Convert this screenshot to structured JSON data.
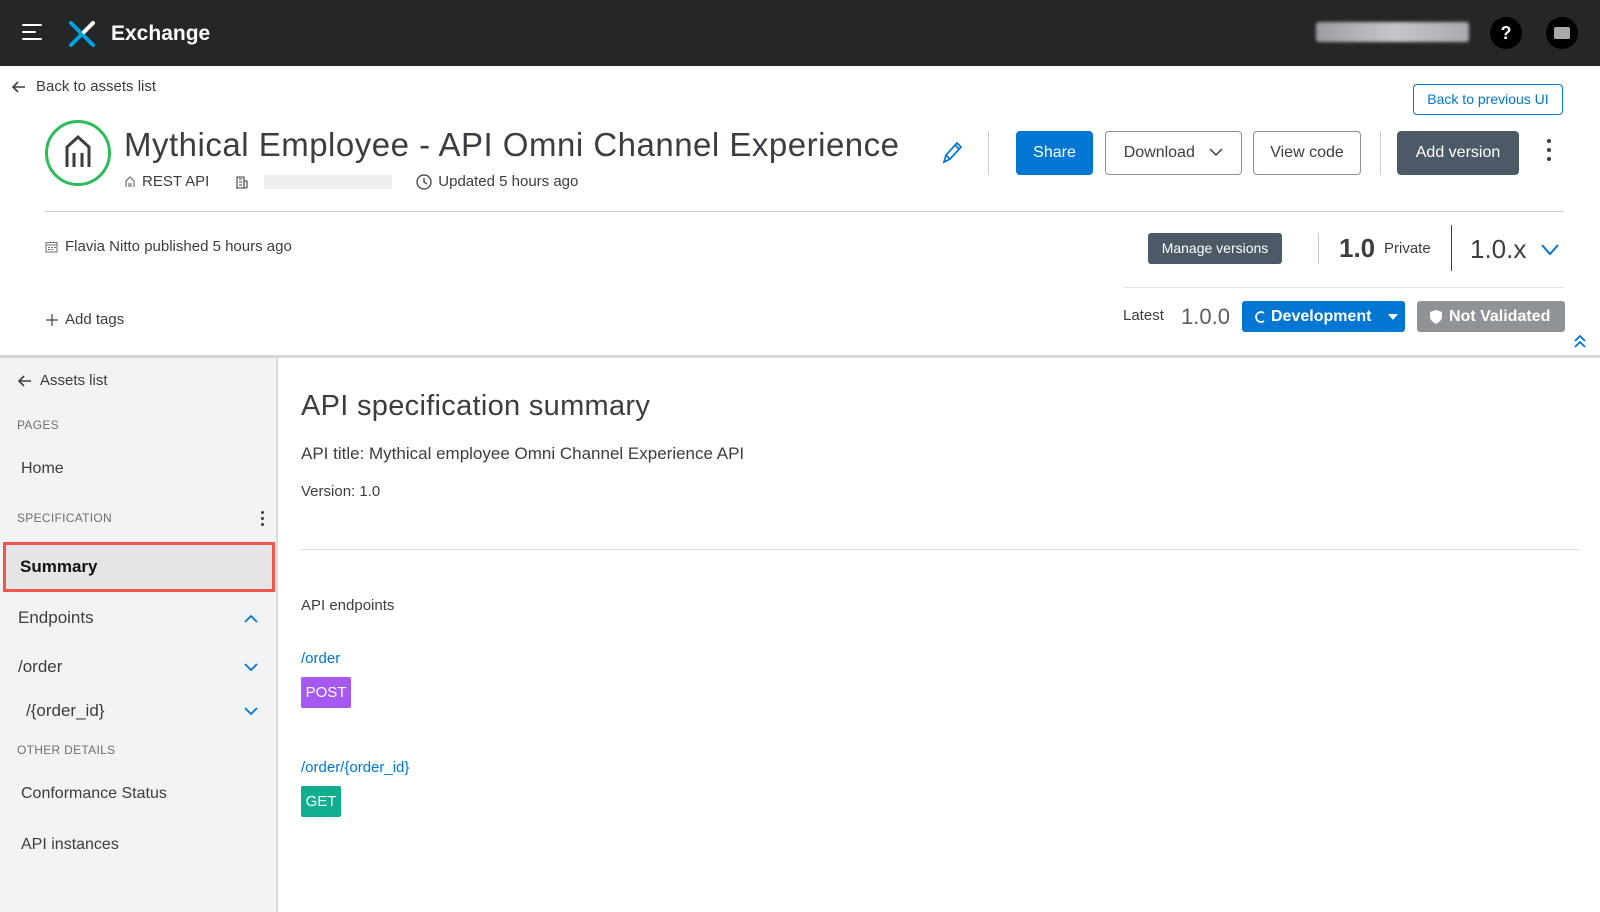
{
  "topbar": {
    "app_name": "Exchange",
    "help_label": "?"
  },
  "header": {
    "back_label": "Back to assets list",
    "back_prev_ui": "Back to previous UI",
    "title": "Mythical Employee - API Omni Channel Experience",
    "asset_type": "REST API",
    "updated": "Updated 5 hours ago",
    "share": "Share",
    "download": "Download",
    "view_code": "View code",
    "add_version": "Add version",
    "published": "Flavia Nitto published 5 hours ago",
    "manage_versions": "Manage versions",
    "version": "1.0",
    "visibility": "Private",
    "version_select": "1.0.x",
    "add_tags": "Add tags",
    "latest_label": "Latest",
    "latest_version": "1.0.0",
    "lifecycle": "Development",
    "validation": "Not Validated"
  },
  "sidebar": {
    "back_label": "Assets list",
    "section_pages": "PAGES",
    "home": "Home",
    "section_spec": "SPECIFICATION",
    "summary": "Summary",
    "endpoints": "Endpoints",
    "order": "/order",
    "order_id": "/{order_id}",
    "section_other": "OTHER DETAILS",
    "conformance": "Conformance Status",
    "instances": "API instances"
  },
  "main": {
    "title": "API specification summary",
    "api_title": "API title: Mythical employee Omni Channel Experience API",
    "version": "Version: 1.0",
    "endpoints_label": "API endpoints",
    "endpoints": [
      {
        "path": "/order",
        "method": "POST"
      },
      {
        "path": "/order/{order_id}",
        "method": "GET"
      }
    ]
  },
  "colors": {
    "brand_blue": "#0176d3",
    "post": "#a659f0",
    "get": "#0fae8e",
    "asset_ring": "#2ebb5c",
    "highlight": "#f2564a"
  }
}
